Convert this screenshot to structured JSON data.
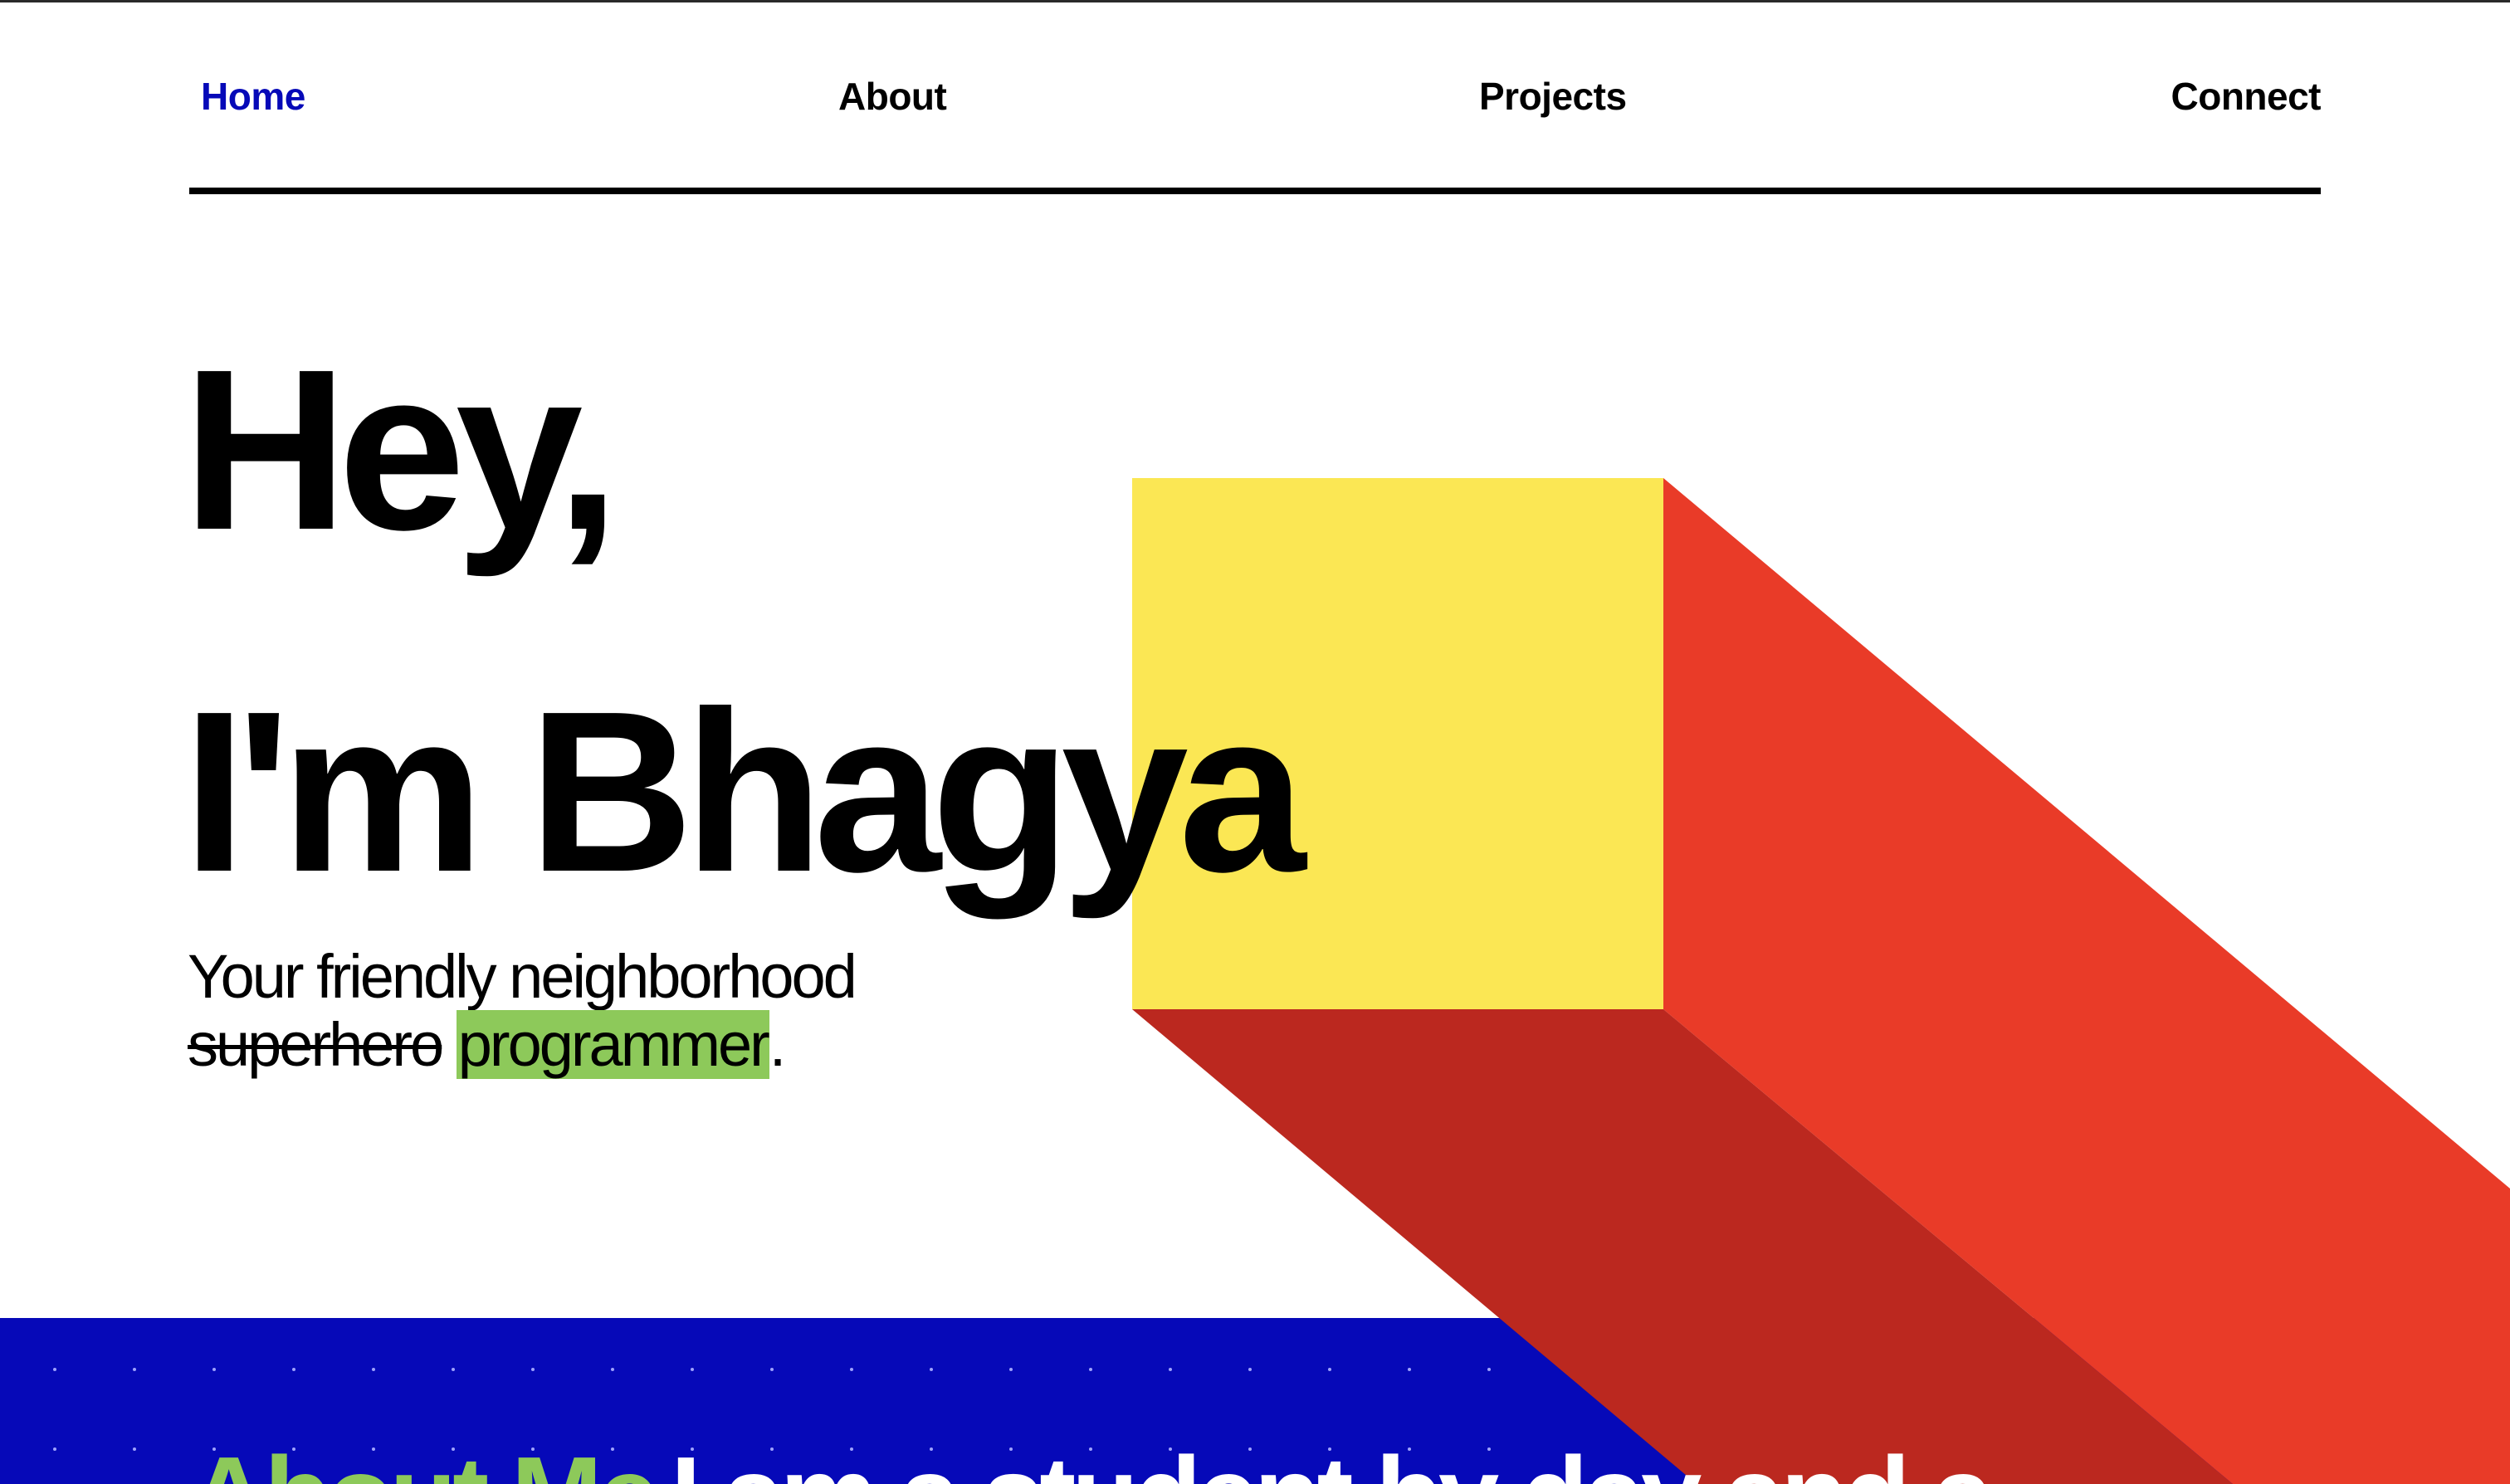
{
  "nav": {
    "items": [
      {
        "label": "Home",
        "active": true
      },
      {
        "label": "About",
        "active": false
      },
      {
        "label": "Projects",
        "active": false
      },
      {
        "label": "Connect",
        "active": false
      }
    ]
  },
  "hero": {
    "greeting": "Hey,",
    "name_line": "I'm Bhagya",
    "tagline_prefix": "Your friendly neighborhood",
    "tagline_struck": "superhero",
    "tagline_highlight": "programmer",
    "tagline_suffix": "."
  },
  "about": {
    "heading": "About Me",
    "intro": "I am a student by day and a"
  },
  "colors": {
    "accent_blue": "#0609b8",
    "highlight_green": "#8dc95a",
    "cube_yellow": "#fbe754",
    "cube_red": "#e93b28",
    "cube_dark_red": "#bb281f"
  }
}
